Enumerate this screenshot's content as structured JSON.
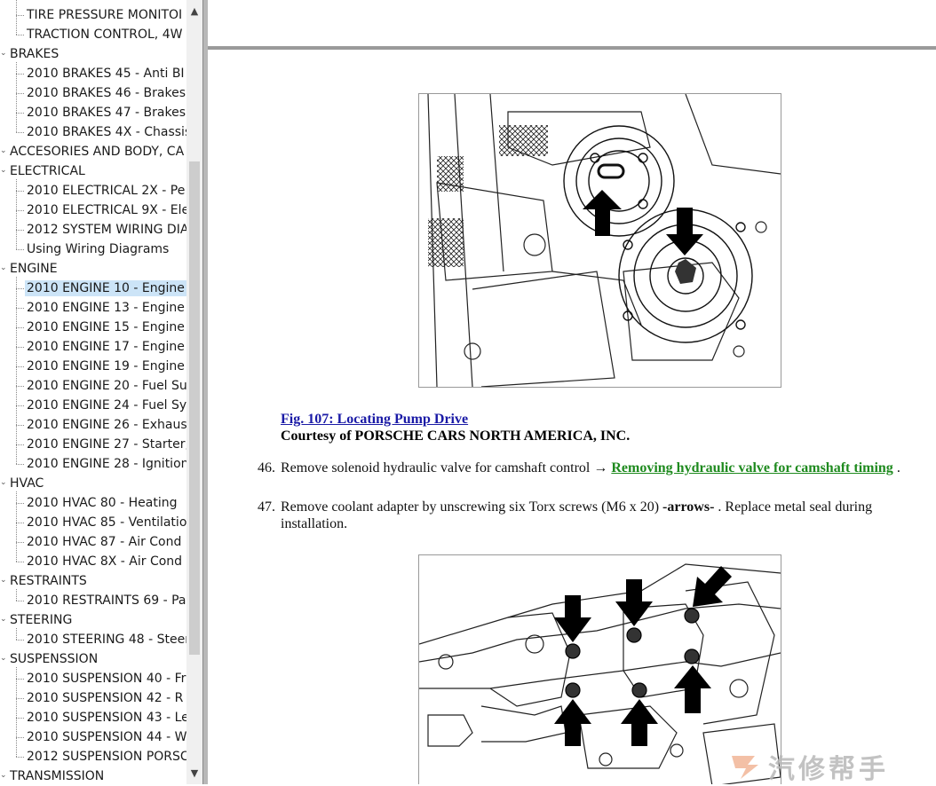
{
  "tree": [
    {
      "label": "TIRE PRESSURE MONITOI",
      "level": 1
    },
    {
      "label": "TRACTION CONTROL, 4W",
      "level": 1
    },
    {
      "label": "BRAKES",
      "level": 0
    },
    {
      "label": "2010 BRAKES 45 - Anti BI",
      "level": 1
    },
    {
      "label": "2010 BRAKES 46 - Brakes",
      "level": 1
    },
    {
      "label": "2010 BRAKES 47 - Brakes",
      "level": 1
    },
    {
      "label": "2010 BRAKES 4X - Chassis",
      "level": 1
    },
    {
      "label": "ACCESORIES AND BODY, CA",
      "level": 0
    },
    {
      "label": "ELECTRICAL",
      "level": 0
    },
    {
      "label": "2010 ELECTRICAL 2X - Pe",
      "level": 1
    },
    {
      "label": "2010 ELECTRICAL 9X - Ele",
      "level": 1
    },
    {
      "label": "2012 SYSTEM WIRING DIA",
      "level": 1
    },
    {
      "label": "Using Wiring Diagrams",
      "level": 1
    },
    {
      "label": "ENGINE",
      "level": 0
    },
    {
      "label": "2010 ENGINE 10 - Engine",
      "level": 1,
      "selected": true
    },
    {
      "label": "2010 ENGINE 13 - Engine",
      "level": 1
    },
    {
      "label": "2010 ENGINE 15 - Engine",
      "level": 1
    },
    {
      "label": "2010 ENGINE 17 - Engine",
      "level": 1
    },
    {
      "label": "2010 ENGINE 19 - Engine",
      "level": 1
    },
    {
      "label": "2010 ENGINE 20 - Fuel Su",
      "level": 1
    },
    {
      "label": "2010 ENGINE 24 - Fuel Sy",
      "level": 1
    },
    {
      "label": "2010 ENGINE 26 - Exhaus",
      "level": 1
    },
    {
      "label": "2010 ENGINE 27 - Starter,",
      "level": 1
    },
    {
      "label": "2010 ENGINE 28 - Ignition",
      "level": 1
    },
    {
      "label": "HVAC",
      "level": 0
    },
    {
      "label": "2010 HVAC 80 - Heating",
      "level": 1
    },
    {
      "label": "2010 HVAC 85 - Ventilatio",
      "level": 1
    },
    {
      "label": "2010 HVAC 87 - Air Cond",
      "level": 1
    },
    {
      "label": "2010 HVAC 8X - Air Cond",
      "level": 1
    },
    {
      "label": "RESTRAINTS",
      "level": 0
    },
    {
      "label": "2010 RESTRAINTS 69 - Pa",
      "level": 1
    },
    {
      "label": "STEERING",
      "level": 0
    },
    {
      "label": "2010 STEERING 48 - Steer",
      "level": 1
    },
    {
      "label": "SUSPENSSION",
      "level": 0
    },
    {
      "label": "2010 SUSPENSION 40 - Fr",
      "level": 1
    },
    {
      "label": "2010 SUSPENSION 42 - R",
      "level": 1
    },
    {
      "label": "2010 SUSPENSION 43 - Le",
      "level": 1
    },
    {
      "label": "2010 SUSPENSION 44 - W",
      "level": 1
    },
    {
      "label": "2012 SUSPENSION PORSC",
      "level": 1
    },
    {
      "label": "TRANSMISSION",
      "level": 0
    }
  ],
  "scroll": {
    "up_icon": "▲",
    "down_icon": "▼"
  },
  "content": {
    "fig_caption": {
      "link": "Fig. 107: Locating Pump Drive",
      "courtesy": "Courtesy of PORSCHE CARS NORTH AMERICA, INC."
    },
    "step46": {
      "num": "46.",
      "text_before": "Remove solenoid hydraulic valve for camshaft control → ",
      "link": "Removing hydraulic valve for camshaft timing",
      "text_after": " ."
    },
    "step47": {
      "num": "47.",
      "text_before": "Remove coolant adapter by unscrewing six Torx screws (M6 x 20) ",
      "bold": "-arrows-",
      "text_after": " . Replace metal seal during installation."
    }
  },
  "watermark": {
    "text": "汽修帮手"
  },
  "colors": {
    "link_blue": "#1a1aa6",
    "link_green": "#1e8a1e",
    "selected_bg": "#cce4f7"
  }
}
